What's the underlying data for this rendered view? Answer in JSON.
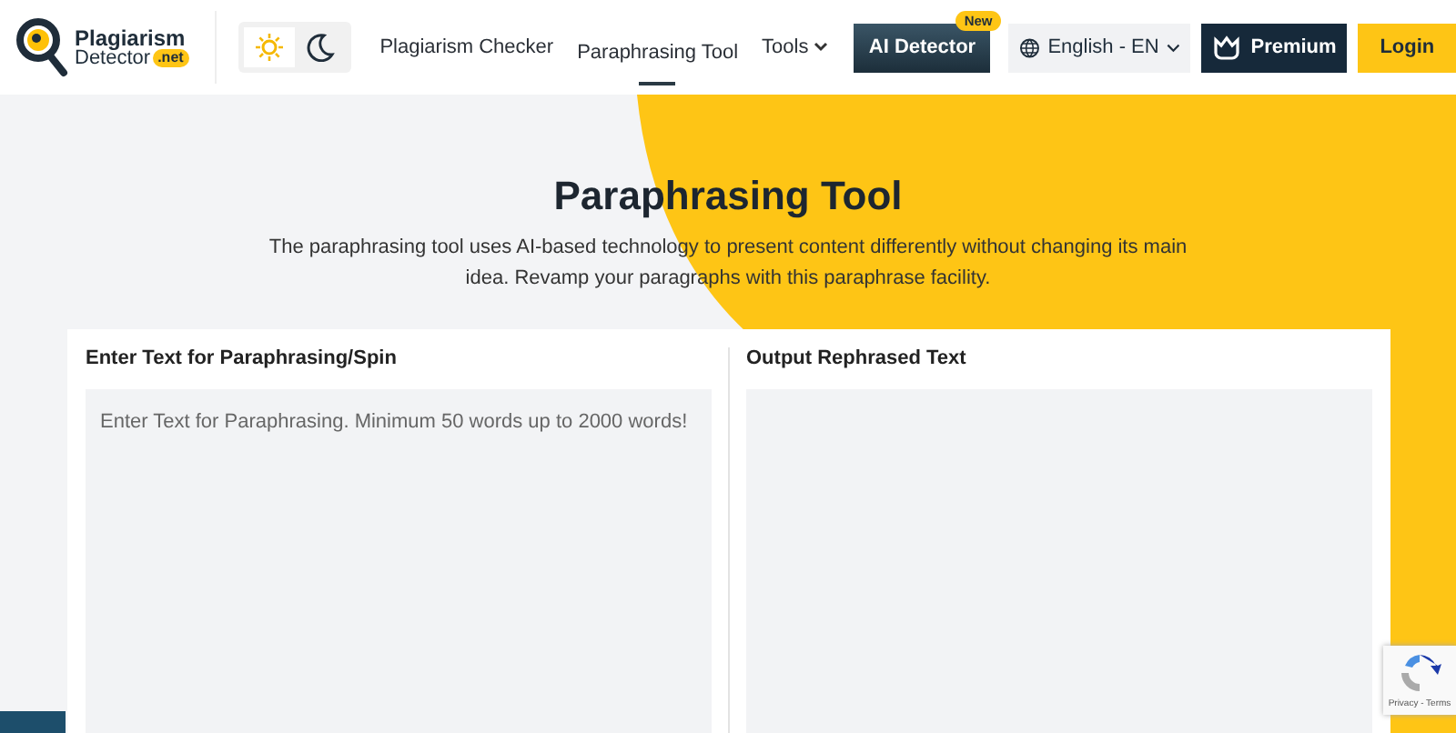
{
  "logo": {
    "line1": "Plagiarism",
    "line2": "Detector",
    "badge": ".net"
  },
  "theme_toggle": [
    {
      "kind": "light",
      "selected": true
    },
    {
      "kind": "dark",
      "selected": false
    }
  ],
  "nav": [
    {
      "label": "Plagiarism Checker",
      "selected": false
    },
    {
      "label": "Paraphrasing Tool",
      "selected": true
    },
    {
      "label": "Tools",
      "selected": false
    }
  ],
  "ai_detector": {
    "label": "AI Detector",
    "badge": "New"
  },
  "language": {
    "label": "English - EN"
  },
  "premium": {
    "label": "Premium"
  },
  "login": {
    "label": "Login"
  },
  "hero": {
    "title": "Paraphrasing Tool",
    "description": "The paraphrasing tool uses AI-based technology to present content differently without changing its main idea. Revamp your paragraphs with this paraphrase facility."
  },
  "input_panel": {
    "title": "Enter Text for Paraphrasing/Spin",
    "placeholder": "Enter Text for Paraphrasing. Minimum 50 words up to 2000 words!"
  },
  "output_panel": {
    "title": "Output Rephrased Text"
  },
  "recaptcha": {
    "links": "Privacy - Terms"
  }
}
